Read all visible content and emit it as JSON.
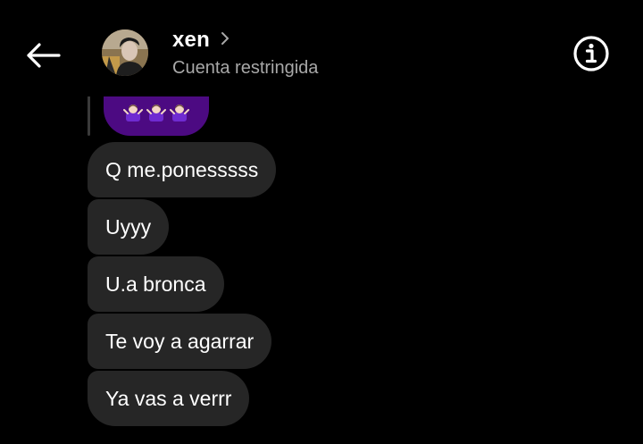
{
  "header": {
    "back_icon": "arrow-left-icon",
    "username": "xen",
    "chevron_icon": "chevron-right-icon",
    "status": "Cuenta restringida",
    "info_icon": "info-circle-icon"
  },
  "messages": {
    "reply_emoji": "🤷🏻‍♀️🤷🏻‍♀️🤷🏻‍♀️",
    "items": [
      {
        "text": "Q me.ponesssss"
      },
      {
        "text": "Uyyy"
      },
      {
        "text": "U.a bronca"
      },
      {
        "text": "Te voy a agarrar"
      },
      {
        "text": "Ya vas a verrr"
      }
    ]
  },
  "colors": {
    "background": "#000000",
    "bubble": "#262626",
    "reply_bubble": "#4c0a82",
    "secondary_text": "#a8a8a8"
  }
}
